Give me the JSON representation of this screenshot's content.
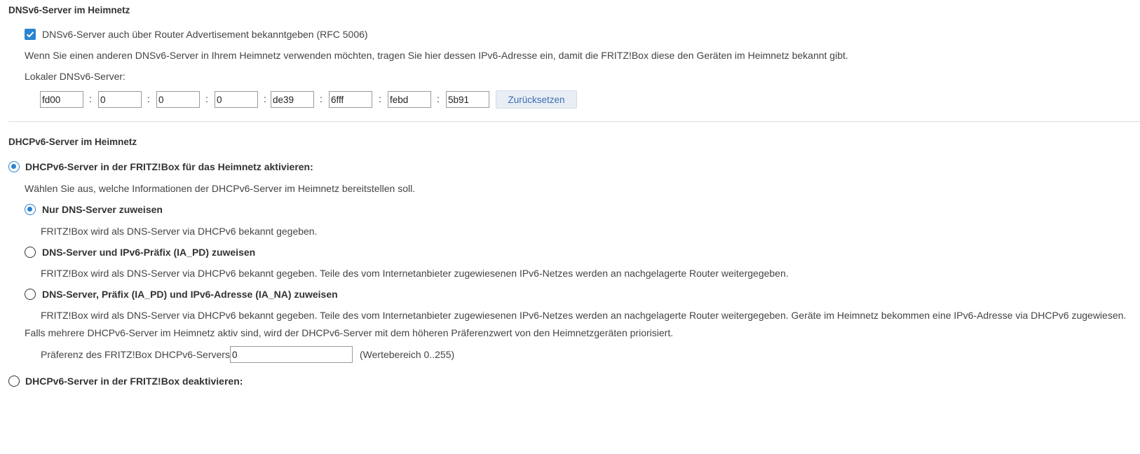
{
  "dnsv6_section": {
    "title": "DNSv6-Server im Heimnetz",
    "ra_checkbox_label": "DNSv6-Server auch über Router Advertisement bekanntgeben (RFC 5006)",
    "ra_checked": true,
    "description": "Wenn Sie einen anderen DNSv6-Server in Ihrem Heimnetz verwenden möchten, tragen Sie hier dessen IPv6-Adresse ein, damit die FRITZ!Box diese den Geräten im Heimnetz bekannt gibt.",
    "local_server_label": "Lokaler DNSv6-Server:",
    "ip_separator": ":",
    "ip_segments": [
      "fd00",
      "0",
      "0",
      "0",
      "de39",
      "6fff",
      "febd",
      "5b91"
    ],
    "reset_button": "Zurücksetzen"
  },
  "dhcpv6_section": {
    "title": "DHCPv6-Server im Heimnetz",
    "enable_label": "DHCPv6-Server in der FRITZ!Box für das Heimnetz aktivieren:",
    "enable_selected": true,
    "choose_text": "Wählen Sie aus, welche Informationen der DHCPv6-Server im Heimnetz bereitstellen soll.",
    "options": [
      {
        "label": "Nur DNS-Server zuweisen",
        "description": "FRITZ!Box wird als DNS-Server via DHCPv6 bekannt gegeben.",
        "selected": true
      },
      {
        "label": "DNS-Server und IPv6-Präfix (IA_PD) zuweisen",
        "description": "FRITZ!Box wird als DNS-Server via DHCPv6 bekannt gegeben. Teile des vom Internetanbieter zugewiesenen IPv6-Netzes werden an nachgelagerte Router weitergegeben.",
        "selected": false
      },
      {
        "label": "DNS-Server, Präfix (IA_PD) und IPv6-Adresse (IA_NA) zuweisen",
        "description": "FRITZ!Box wird als DNS-Server via DHCPv6 bekannt gegeben. Teile des vom Internetanbieter zugewiesenen IPv6-Netzes werden an nachgelagerte Router weitergegeben. Geräte im Heimnetz bekommen eine IPv6-Adresse via DHCPv6 zugewiesen.",
        "selected": false
      }
    ],
    "multiple_servers_note": "Falls mehrere DHCPv6-Server im Heimnetz aktiv sind, wird der DHCPv6-Server mit dem höheren Präferenzwert von den Heimnetzgeräten priorisiert.",
    "preference_label": "Präferenz des FRITZ!Box DHCPv6-Servers:",
    "preference_value": "0",
    "preference_range": "(Wertebereich 0..255)",
    "disable_label": "DHCPv6-Server in der FRITZ!Box deaktivieren:",
    "disable_selected": false
  },
  "colors": {
    "accent": "#2a83cf",
    "button_bg": "#e9eef5",
    "button_text": "#3b6db0",
    "divider": "#dcdcdc"
  }
}
